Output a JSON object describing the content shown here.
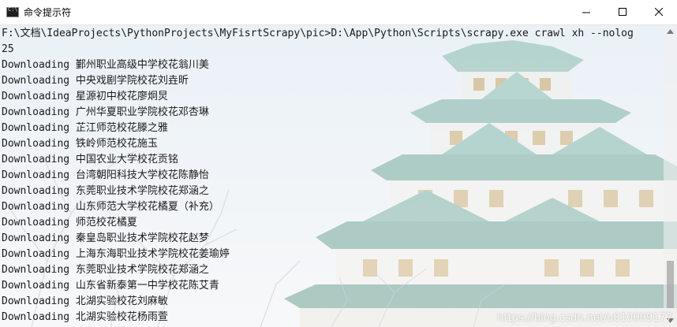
{
  "window": {
    "title": "命令提示符"
  },
  "terminal": {
    "lines": [
      "F:\\文档\\IdeaProjects\\PythonProjects\\MyFisrtScrapy\\pic>D:\\App\\Python\\Scripts\\scrapy.exe crawl xh --nolog",
      "25",
      "Downloading 鄞州职业高级中学校花翁川美",
      "Downloading 中央戏剧学院校花刘垚昕",
      "Downloading 星源初中校花廖炯炅",
      "Downloading 广州华夏职业学院校花邓杏琳",
      "Downloading 芷江师范校花滕之雅",
      "Downloading 铁岭师范校花施玉",
      "Downloading 中国农业大学校花贡铭",
      "Downloading 台湾朝阳科技大学校花陈静怡",
      "Downloading 东莞职业技术学院校花郑涵之",
      "Downloading 山东师范大学校花橘夏（补充）",
      "Downloading 师范校花橘夏",
      "Downloading 秦皇岛职业技术学院校花赵梦",
      "Downloading 上海东海职业技术学院校花姜瑜婷",
      "Downloading 东莞职业技术学院校花郑涵之",
      "Downloading 山东省新泰第一中学校花陈艾青",
      "Downloading 北湖实验校花刘麻敏",
      "Downloading 北湖实验校花杨雨萱"
    ]
  },
  "watermark": "https://blog.csdn.net/u010009177",
  "colors": {
    "sky": "#e9f0f6",
    "roof": "#7fb3a6",
    "wall": "#f3f1ec",
    "gold": "#d9b77a"
  }
}
